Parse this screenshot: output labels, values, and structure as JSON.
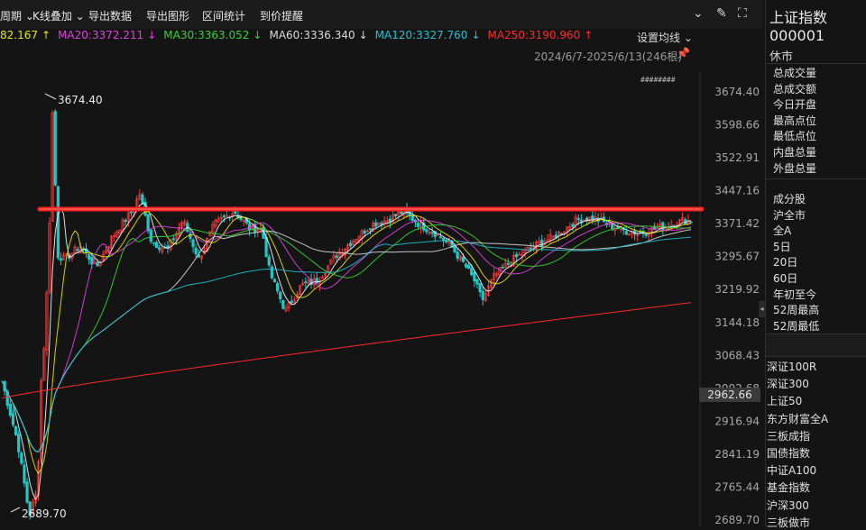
{
  "toolbar": {
    "items": [
      "周期 ⌄",
      "K线叠加 ⌄",
      "导出数据",
      "导出图形",
      "区间统计",
      "到价提醒"
    ],
    "icons": [
      "chevron-circle-icon",
      "brush-icon",
      "fullscreen-icon"
    ]
  },
  "ma_row": [
    {
      "label": "82.167",
      "arrow": "↑",
      "color": "#e6e600"
    },
    {
      "label": "MA20:3372.211",
      "arrow": "↓",
      "color": "#e040e0"
    },
    {
      "label": "MA30:3363.052",
      "arrow": "↓",
      "color": "#36d136"
    },
    {
      "label": "MA60:3336.340",
      "arrow": "↓",
      "color": "#d8d8d8"
    },
    {
      "label": "MA120:3327.760",
      "arrow": "↓",
      "color": "#20c0d0"
    },
    {
      "label": "MA250:3190.960",
      "arrow": "↑",
      "color": "#ff2a2a"
    }
  ],
  "settings_label": "设置均线 ⌄",
  "range_label": "2024/6/7-2025/6/13(246根)",
  "price_axis": [
    "3674.40",
    "3598.66",
    "3522.91",
    "3447.16",
    "3371.42",
    "3295.67",
    "3219.92",
    "3144.18",
    "3068.43",
    "2992.68",
    "2916.94",
    "2841.19",
    "2765.44",
    "2689.70"
  ],
  "current_price": "2962.66",
  "annotations": {
    "high": "3674.40",
    "low": "2689.70"
  },
  "colors": {
    "up": "#ff3b3b",
    "down": "#20c8c8",
    "resistance": "#ff2020"
  },
  "right_panel": {
    "name": "上证指数",
    "code": "000001",
    "status": "休市",
    "stats": [
      "总成交量",
      "总成交额",
      "今日开盘",
      "最高点位",
      "最低点位",
      "内盘总量",
      "外盘总量"
    ],
    "categories": [
      "成分股",
      "沪全市",
      "全A",
      "5日",
      "20日",
      "60日",
      "年初至今",
      "52周最高",
      "52周最低"
    ],
    "indices": [
      "深证100R",
      "深证300",
      "上证50",
      "东方财富全A",
      "三板成指",
      "国债指数",
      "中证A100",
      "基金指数",
      "沪深300",
      "三板做市"
    ]
  }
}
